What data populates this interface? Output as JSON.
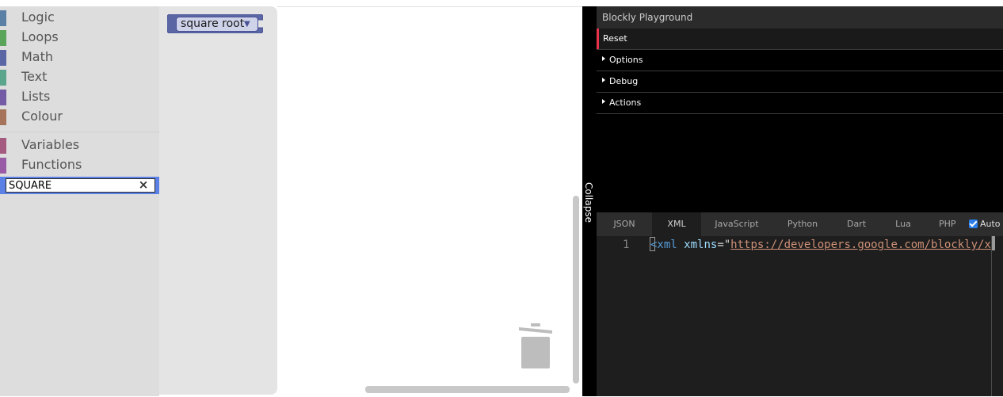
{
  "toolbox": {
    "categories": [
      {
        "label": "Logic",
        "color": "#5b80a5"
      },
      {
        "label": "Loops",
        "color": "#5ba55b"
      },
      {
        "label": "Math",
        "color": "#5b67a5"
      },
      {
        "label": "Text",
        "color": "#5ba58c"
      },
      {
        "label": "Lists",
        "color": "#745ba5"
      },
      {
        "label": "Colour",
        "color": "#a5745b"
      },
      {
        "label": "Variables",
        "color": "#a55b80"
      },
      {
        "label": "Functions",
        "color": "#995ba5"
      }
    ],
    "search": {
      "value": "SQUARE",
      "clear_icon": "close-icon"
    }
  },
  "flyout": {
    "block": {
      "label": "square root",
      "color": "#5b67a5"
    }
  },
  "collapse": {
    "label": "Collapse"
  },
  "panel": {
    "title": "Blockly Playground",
    "reset": "Reset",
    "sections": [
      "Options",
      "Debug",
      "Actions"
    ]
  },
  "tabs": {
    "items": [
      "JSON",
      "XML",
      "JavaScript",
      "Python",
      "Dart",
      "Lua",
      "PHP"
    ],
    "active": "XML",
    "auto_label": "Auto",
    "auto_checked": true
  },
  "editor": {
    "line_number": "1",
    "tag": "<xml",
    "attr": "xmlns",
    "eq": "=\"",
    "url": "https://developers.google.com/blockly/xml"
  }
}
